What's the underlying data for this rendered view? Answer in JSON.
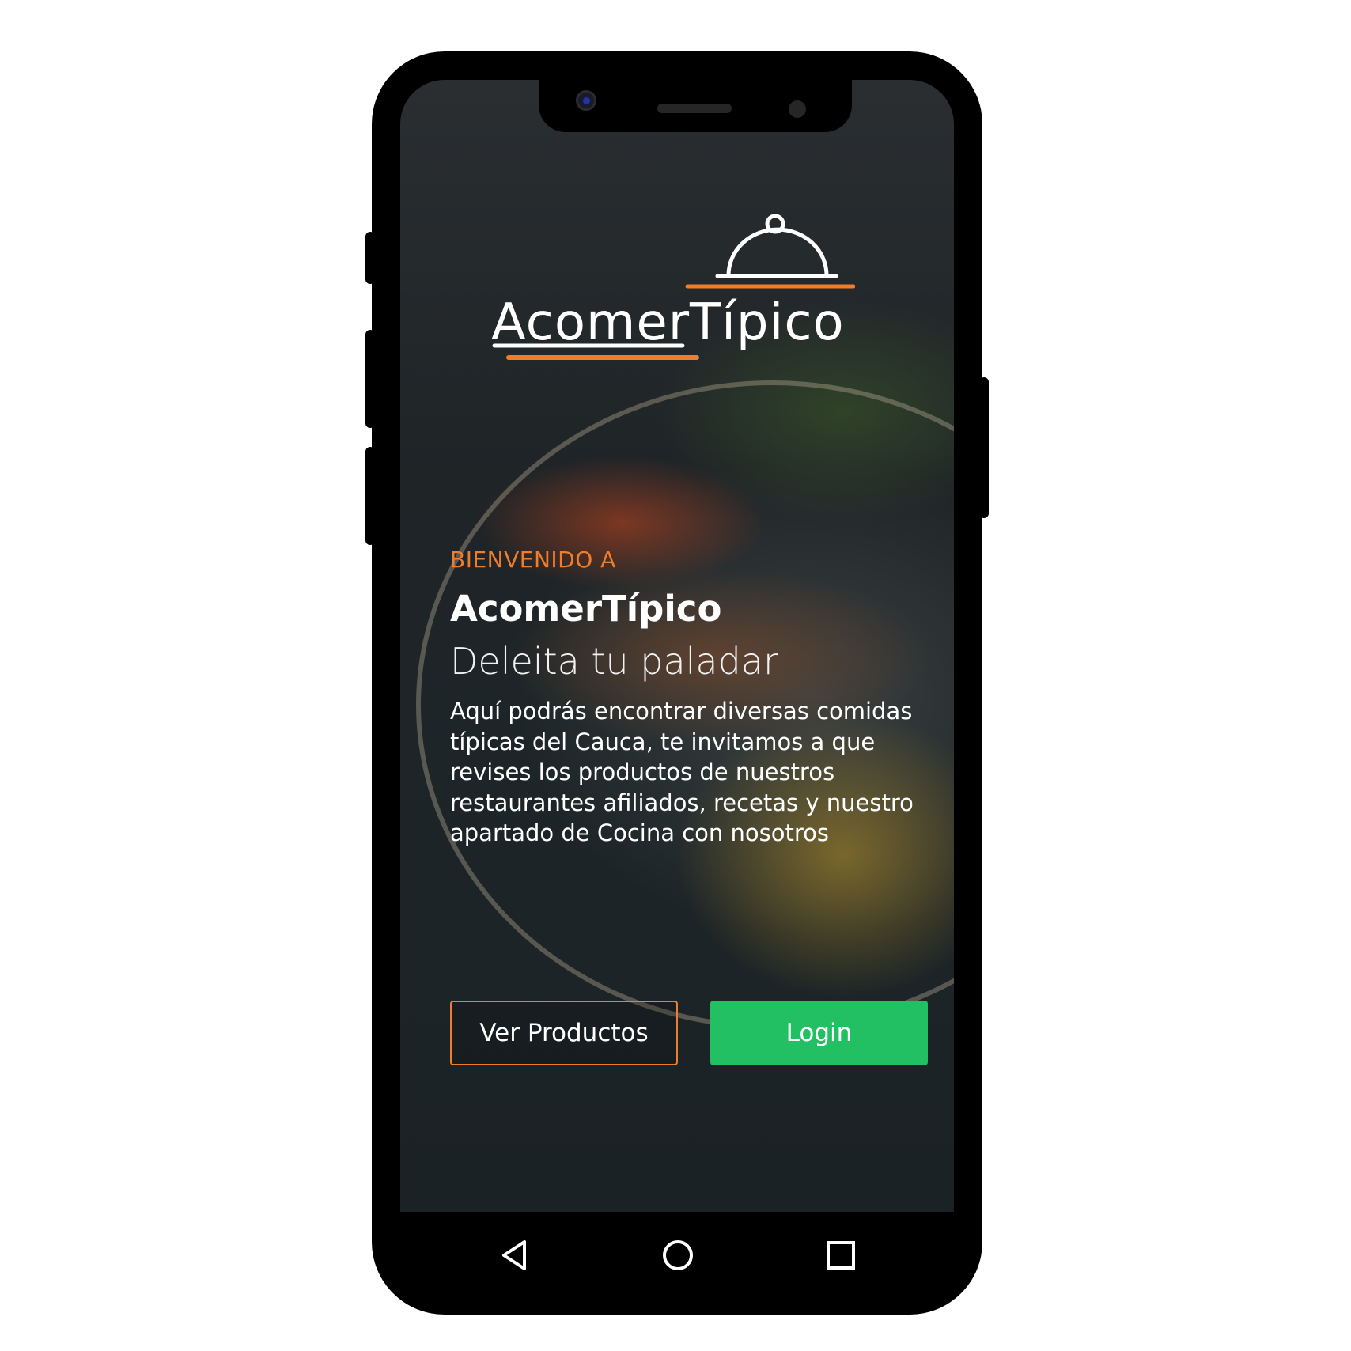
{
  "app": {
    "logo_text": "AcomerTípico",
    "welcome_label": "BIENVENIDO A",
    "brand_name": "AcomerTípico",
    "tagline": "Deleita tu paladar",
    "description": "Aquí podrás encontrar diversas comidas típicas del Cauca, te invitamos a que revises los productos de nuestros restaurantes afiliados, recetas y nuestro apartado de Cocina con nosotros"
  },
  "buttons": {
    "products_label": "Ver Productos",
    "login_label": "Login"
  },
  "colors": {
    "accent_orange": "#ef7d2a",
    "login_green": "#22c062",
    "text_white": "#ffffff"
  },
  "nav": {
    "icons": [
      "back-icon",
      "home-icon",
      "recents-icon"
    ]
  }
}
